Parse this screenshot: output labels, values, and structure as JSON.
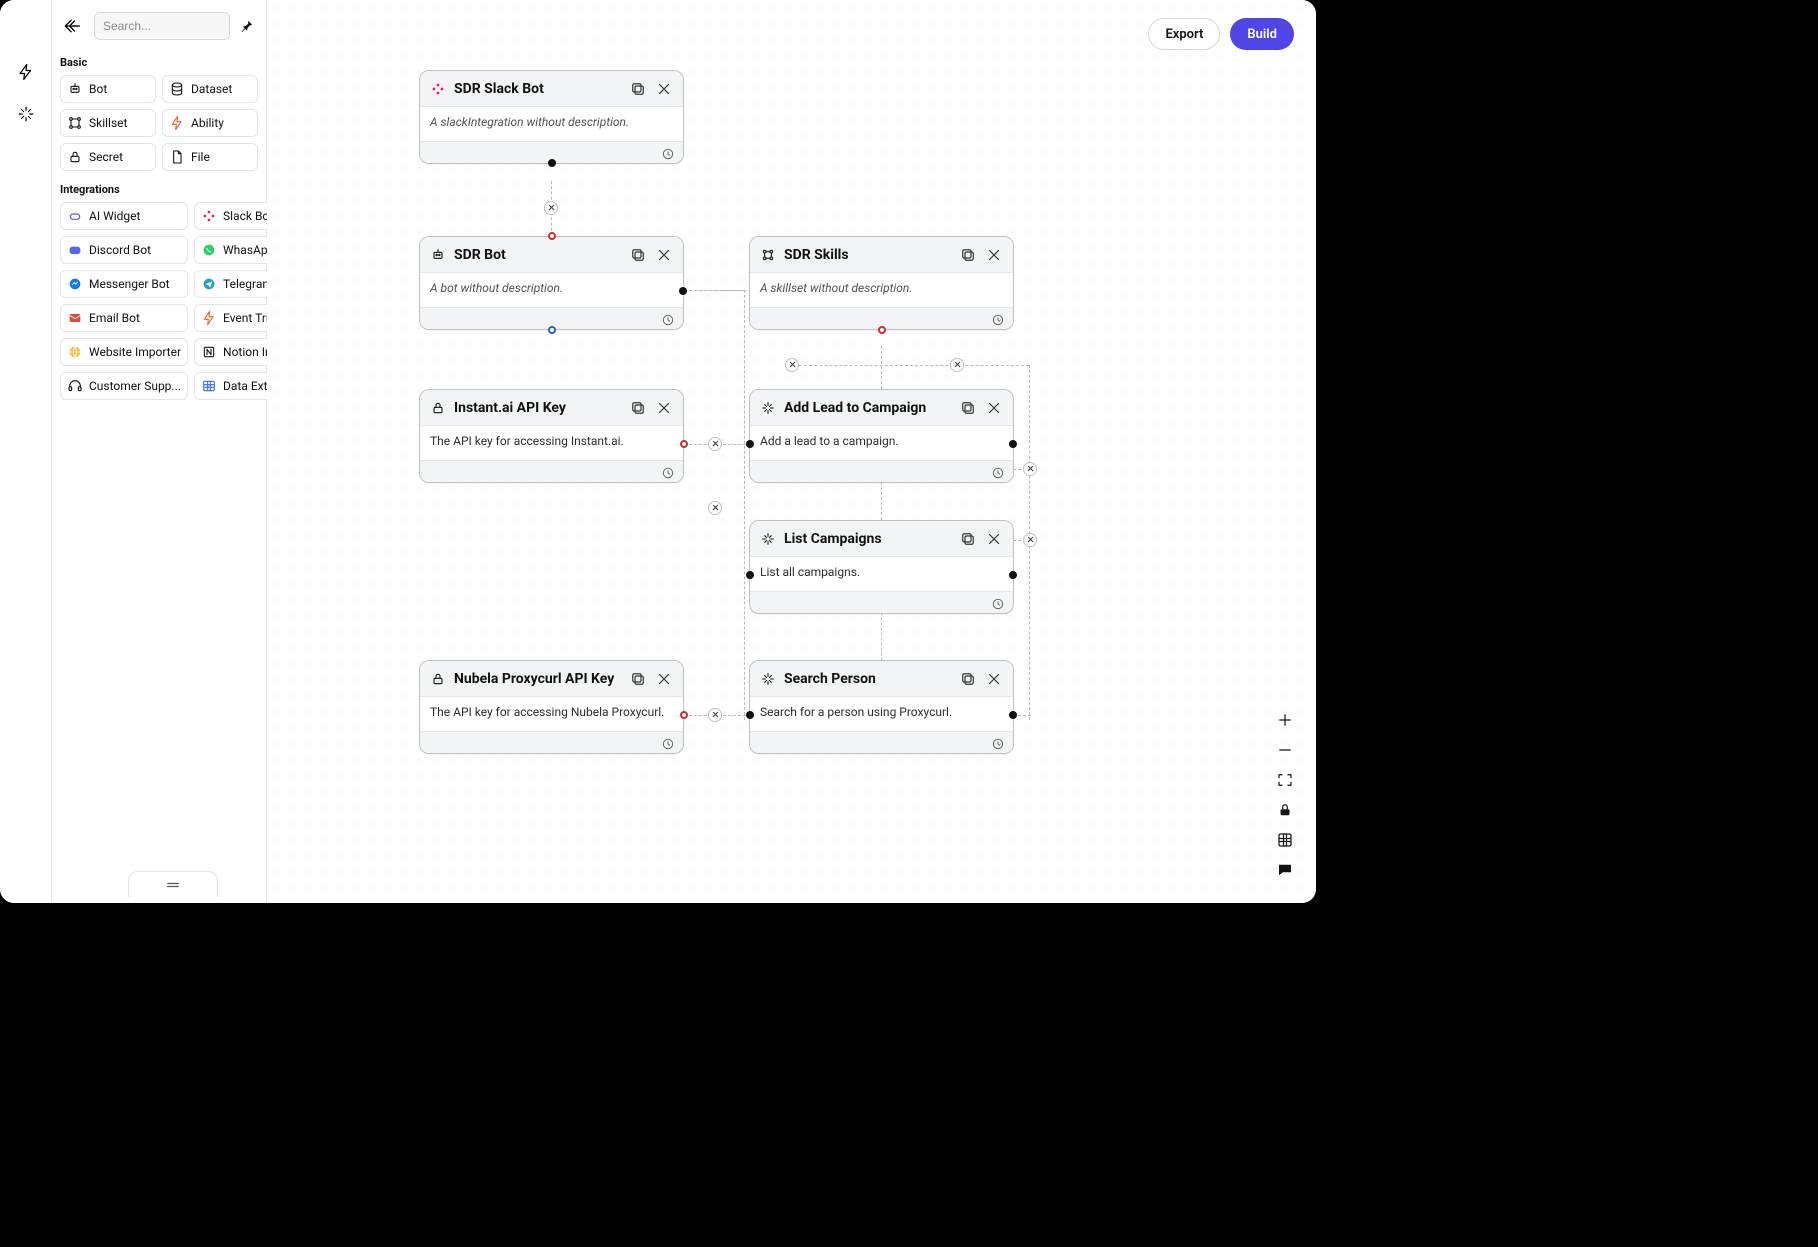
{
  "header": {
    "export_label": "Export",
    "build_label": "Build"
  },
  "search": {
    "placeholder": "Search..."
  },
  "categories": {
    "basic_label": "Basic",
    "basic": [
      {
        "label": "Bot",
        "icon": "robot"
      },
      {
        "label": "Dataset",
        "icon": "db"
      },
      {
        "label": "Skillset",
        "icon": "graph"
      },
      {
        "label": "Ability",
        "icon": "bolt",
        "color": "#f15c2b"
      },
      {
        "label": "Secret",
        "icon": "lock"
      },
      {
        "label": "File",
        "icon": "file"
      }
    ],
    "integrations_label": "Integrations",
    "integrations": [
      {
        "label": "AI Widget",
        "icon": "widget",
        "color": "#5b5be8"
      },
      {
        "label": "Slack Bot",
        "icon": "slack",
        "color": "#e01e5a"
      },
      {
        "label": "Discord Bot",
        "icon": "discord",
        "color": "#5865F2"
      },
      {
        "label": "WhasApp Bot",
        "icon": "whatsapp",
        "color": "#25D366"
      },
      {
        "label": "Messenger Bot",
        "icon": "messenger",
        "color": "#0a7cff"
      },
      {
        "label": "Telegram Bot",
        "icon": "telegram",
        "color": "#229ED9"
      },
      {
        "label": "Email Bot",
        "icon": "mail",
        "color": "#e14b34"
      },
      {
        "label": "Event Trigger",
        "icon": "bolt",
        "color": "#f15c2b"
      },
      {
        "label": "Website Importer",
        "icon": "globe",
        "color": "#f6c042"
      },
      {
        "label": "Notion Importer",
        "icon": "notion",
        "color": "#111"
      },
      {
        "label": "Customer Supp...",
        "icon": "support",
        "color": "#111"
      },
      {
        "label": "Data Extraction",
        "icon": "table",
        "color": "#3a6de6"
      }
    ]
  },
  "nodes": {
    "slackbot": {
      "title": "SDR Slack Bot",
      "desc": "A slackIntegration without description."
    },
    "sdrbot": {
      "title": "SDR Bot",
      "desc": "A bot without description."
    },
    "skills": {
      "title": "SDR Skills",
      "desc": "A skillset without description."
    },
    "instantkey": {
      "title": "Instant.ai API Key",
      "desc": "The API key for accessing Instant.ai."
    },
    "addlead": {
      "title": "Add Lead to Campaign",
      "desc": "Add a lead to a campaign."
    },
    "listcamp": {
      "title": "List Campaigns",
      "desc": "List all campaigns."
    },
    "nubela": {
      "title": "Nubela Proxycurl API Key",
      "desc": "The API key for accessing Nubela Proxycurl."
    },
    "searchperson": {
      "title": "Search Person",
      "desc": "Search for a person using Proxycurl."
    }
  }
}
